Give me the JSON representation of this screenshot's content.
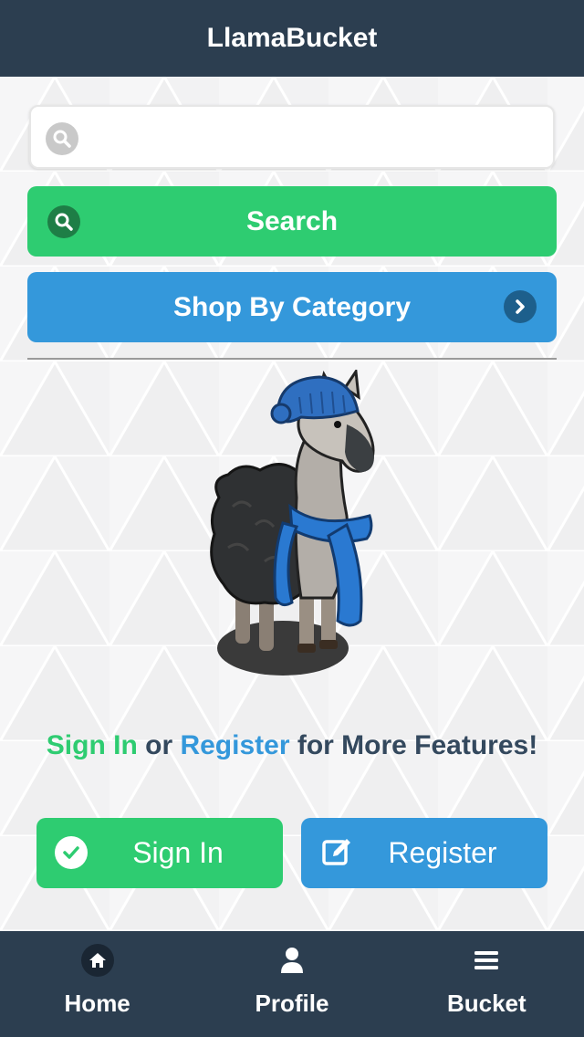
{
  "header": {
    "title": "LlamaBucket"
  },
  "search": {
    "placeholder": "",
    "value": "",
    "button_label": "Search"
  },
  "category": {
    "button_label": "Shop By Category"
  },
  "tagline": {
    "signin_text": "Sign In",
    "or_text": " or ",
    "register_text": "Register",
    "rest_text": " for More Features!"
  },
  "actions": {
    "signin_label": "Sign In",
    "register_label": "Register"
  },
  "tabs": [
    {
      "label": "Home",
      "icon": "home-icon"
    },
    {
      "label": "Profile",
      "icon": "user-icon"
    },
    {
      "label": "Bucket",
      "icon": "bars-icon"
    }
  ],
  "colors": {
    "header_bg": "#2c3e50",
    "green": "#2ecc71",
    "blue": "#3498db",
    "text_dark": "#34495e"
  }
}
